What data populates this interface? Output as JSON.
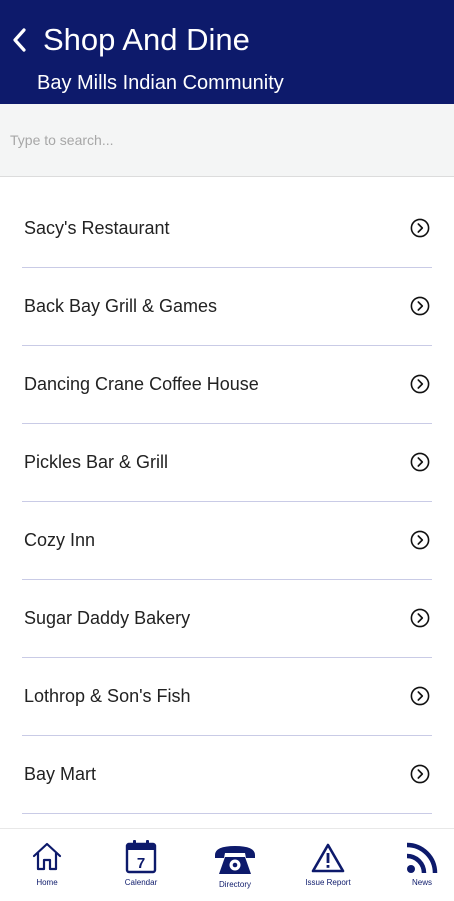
{
  "header": {
    "title": "Shop And Dine",
    "subtitle": "Bay Mills Indian Community",
    "background_color": "#0d1a6b",
    "back_icon": "chevron-left-icon"
  },
  "search": {
    "placeholder": "Type to search...",
    "value": ""
  },
  "list": {
    "items": [
      {
        "label": "Sacy's Restaurant"
      },
      {
        "label": "Back Bay Grill & Games"
      },
      {
        "label": "Dancing Crane Coffee House"
      },
      {
        "label": "Pickles Bar & Grill"
      },
      {
        "label": "Cozy Inn"
      },
      {
        "label": "Sugar Daddy Bakery"
      },
      {
        "label": "Lothrop & Son's Fish"
      },
      {
        "label": "Bay Mart"
      }
    ],
    "row_icon": "chevron-circle-right-icon",
    "divider_color": "#c9cbe6"
  },
  "tabbar": {
    "accent_color": "#0d1a6b",
    "calendar_day": "7",
    "tabs": [
      {
        "label": "Home",
        "icon": "home-icon"
      },
      {
        "label": "Calendar",
        "icon": "calendar-icon"
      },
      {
        "label": "Directory",
        "icon": "telephone-icon"
      },
      {
        "label": "Issue Report",
        "icon": "warning-icon"
      },
      {
        "label": "News",
        "icon": "rss-icon"
      }
    ]
  }
}
